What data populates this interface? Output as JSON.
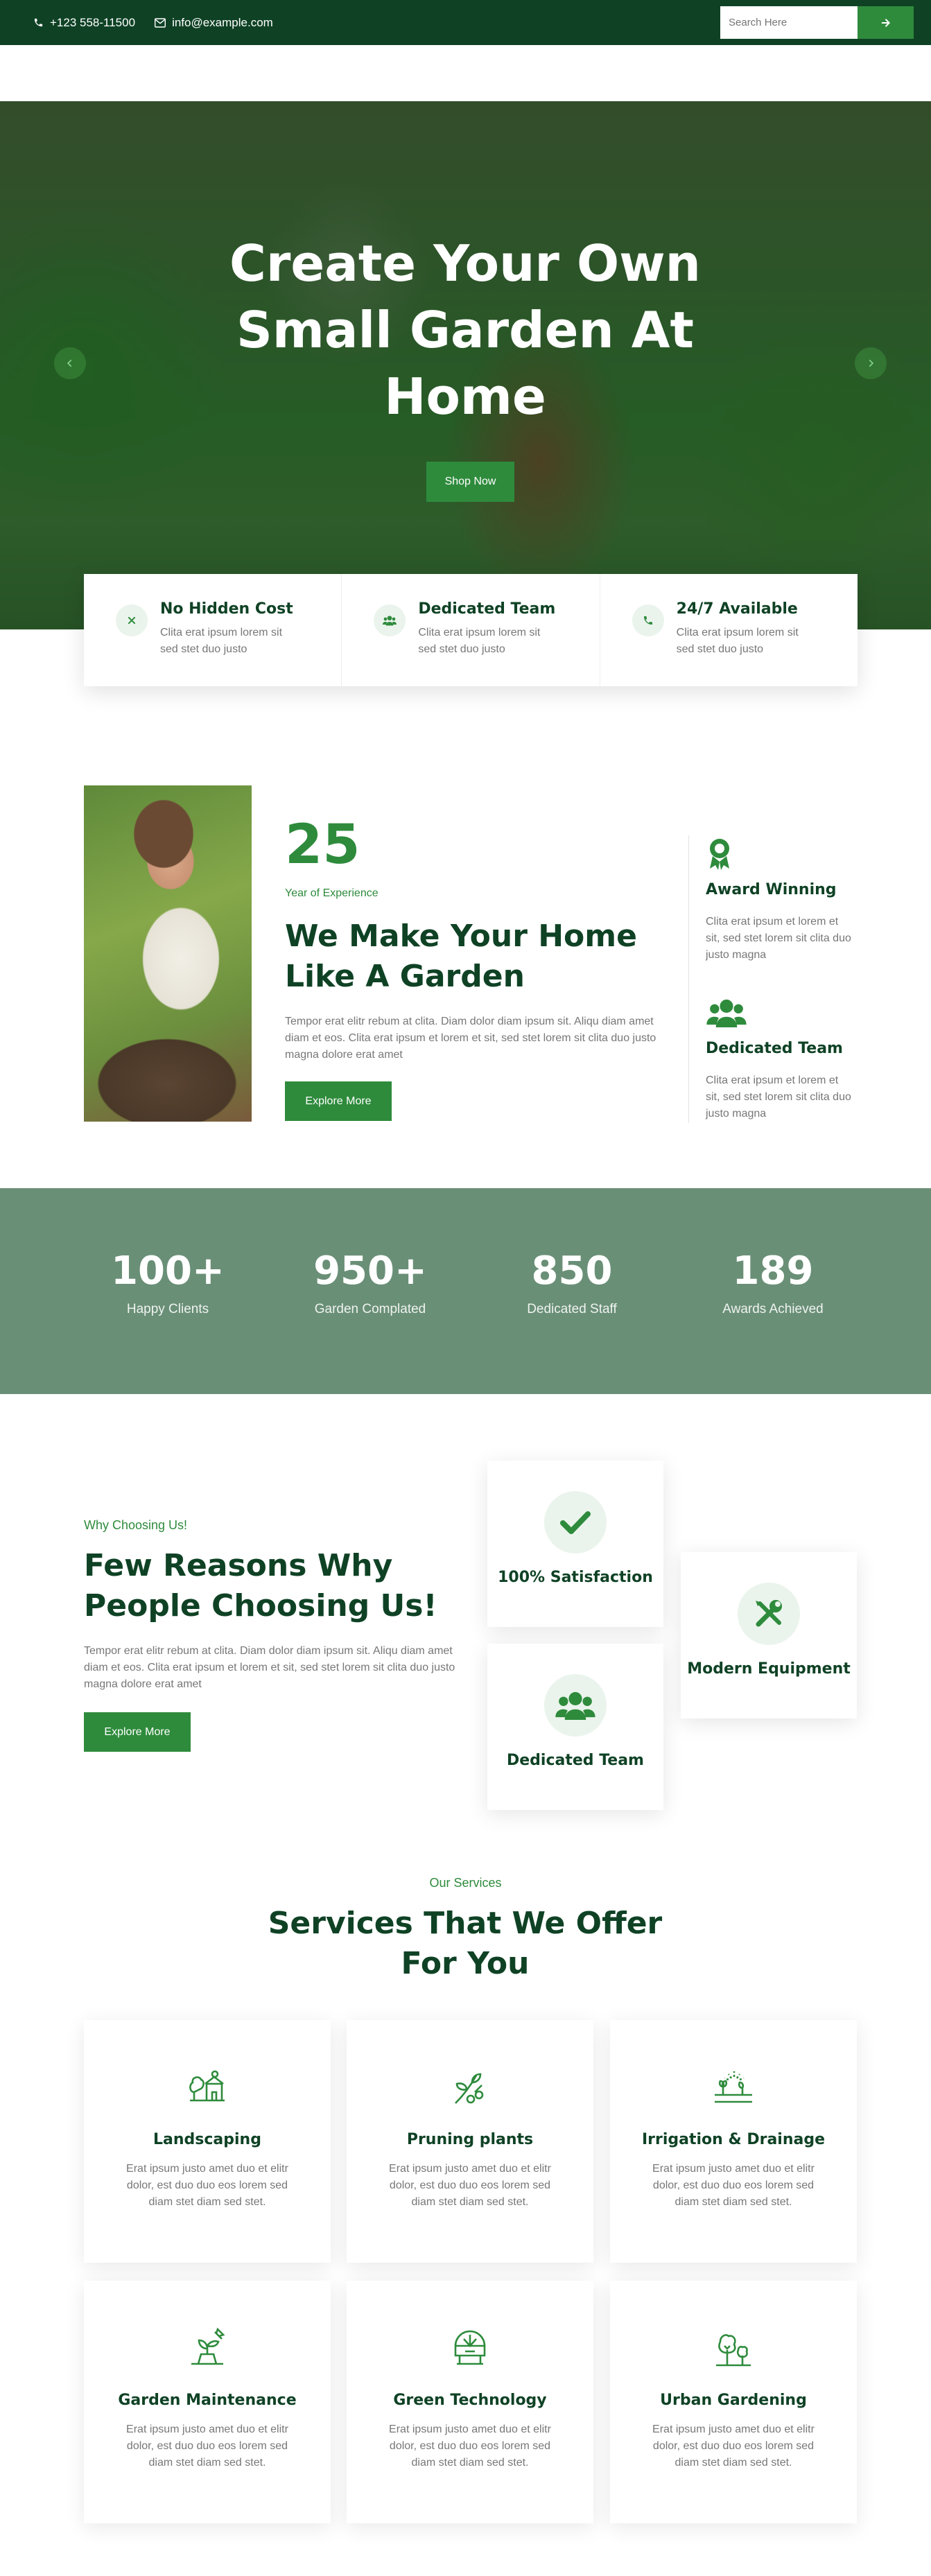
{
  "topbar": {
    "phone": "+123 558-11500",
    "email": "info@example.com",
    "search_placeholder": "Search Here"
  },
  "hero": {
    "title": "Create Your Own Small Garden At Home",
    "button": "Shop Now"
  },
  "features": [
    {
      "icon": "close-icon",
      "title": "No Hidden Cost",
      "text": "Clita erat ipsum lorem sit sed stet duo justo"
    },
    {
      "icon": "users-icon",
      "title": "Dedicated Team",
      "text": "Clita erat ipsum lorem sit sed stet duo justo"
    },
    {
      "icon": "phone-icon",
      "title": "24/7 Available",
      "text": "Clita erat ipsum lorem sit sed stet duo justo"
    }
  ],
  "about": {
    "years": "25",
    "years_label": "Year of Experience",
    "title": "We Make Your Home Like A Garden",
    "text": "Tempor erat elitr rebum at clita. Diam dolor diam ipsum sit. Aliqu diam amet diam et eos. Clita erat ipsum et lorem et sit, sed stet lorem sit clita duo justo magna dolore erat amet",
    "button": "Explore More",
    "side": [
      {
        "icon": "award-icon",
        "title": "Award Winning",
        "text": "Clita erat ipsum et lorem et sit, sed stet lorem sit clita duo justo magna"
      },
      {
        "icon": "users-icon",
        "title": "Dedicated Team",
        "text": "Clita erat ipsum et lorem et sit, sed stet lorem sit clita duo justo magna"
      }
    ]
  },
  "stats": [
    {
      "number": "100+",
      "label": "Happy Clients"
    },
    {
      "number": "950+",
      "label": "Garden Complated"
    },
    {
      "number": "850",
      "label": "Dedicated Staff"
    },
    {
      "number": "189",
      "label": "Awards Achieved"
    }
  ],
  "why": {
    "kicker": "Why Choosing Us!",
    "title": "Few Reasons Why People Choosing Us!",
    "text": "Tempor erat elitr rebum at clita. Diam dolor diam ipsum sit. Aliqu diam amet diam et eos. Clita erat ipsum et lorem et sit, sed stet lorem sit clita duo justo magna dolore erat amet",
    "button": "Explore More",
    "cards": [
      {
        "icon": "check-icon",
        "title": "100% Satisfaction"
      },
      {
        "icon": "users-icon",
        "title": "Dedicated Team"
      },
      {
        "icon": "tools-icon",
        "title": "Modern Equipment"
      }
    ]
  },
  "services": {
    "kicker": "Our Services",
    "title": "Services That We Offer For You",
    "items": [
      {
        "icon": "landscaping-icon",
        "title": "Landscaping",
        "text": "Erat ipsum justo amet duo et elitr dolor, est duo duo eos lorem sed diam stet diam sed stet."
      },
      {
        "icon": "pruning-icon",
        "title": "Pruning plants",
        "text": "Erat ipsum justo amet duo et elitr dolor, est duo duo eos lorem sed diam stet diam sed stet."
      },
      {
        "icon": "irrigation-icon",
        "title": "Irrigation & Drainage",
        "text": "Erat ipsum justo amet duo et elitr dolor, est duo duo eos lorem sed diam stet diam sed stet."
      },
      {
        "icon": "maintenance-icon",
        "title": "Garden Maintenance",
        "text": "Erat ipsum justo amet duo et elitr dolor, est duo duo eos lorem sed diam stet diam sed stet."
      },
      {
        "icon": "green-tech-icon",
        "title": "Green Technology",
        "text": "Erat ipsum justo amet duo et elitr dolor, est duo duo eos lorem sed diam stet diam sed stet."
      },
      {
        "icon": "urban-gardening-icon",
        "title": "Urban Gardening",
        "text": "Erat ipsum justo amet duo et elitr dolor, est duo duo eos lorem sed diam stet diam sed stet."
      }
    ]
  },
  "colors": {
    "dark_green": "#0f4225",
    "accent_green": "#2e8b3c",
    "stats_bg": "#6a8f77"
  }
}
